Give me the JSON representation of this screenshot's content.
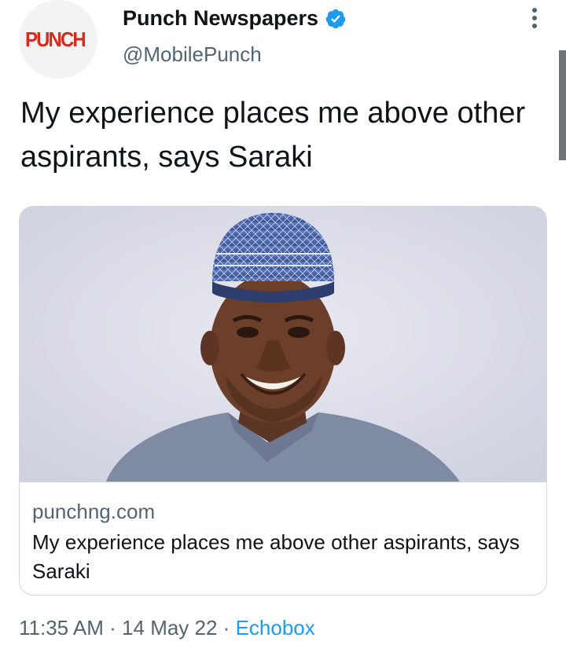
{
  "author": {
    "name": "Punch Newspapers",
    "handle": "@MobilePunch",
    "avatar_logo_text": "PUNCH",
    "verified": true
  },
  "tweet": {
    "text": "My experience places me above other aspirants, says Saraki"
  },
  "link_card": {
    "domain": "punchng.com",
    "title": "My experience places me above other aspirants, says Saraki"
  },
  "meta": {
    "time": "11:35 AM",
    "sep1": " · ",
    "date": "14 May 22",
    "sep2": " · ",
    "source": "Echobox"
  },
  "colors": {
    "text_primary": "#0f1419",
    "text_secondary": "#536471",
    "accent": "#1d9bf0",
    "logo_red": "#d42a1f"
  },
  "icons": {
    "verified": "verified-badge-icon",
    "more": "more-options-icon"
  }
}
